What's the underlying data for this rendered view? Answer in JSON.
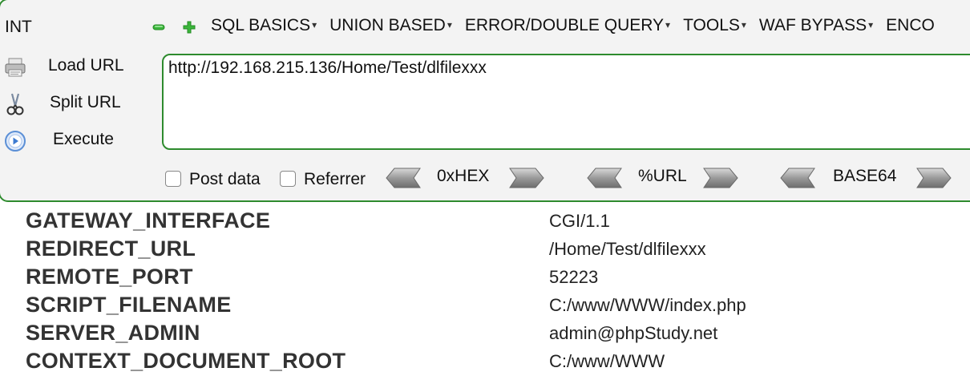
{
  "toolbar": {
    "name_fragment": "INT",
    "menu": [
      {
        "label": "SQL BASICS"
      },
      {
        "label": "UNION BASED"
      },
      {
        "label": "ERROR/DOUBLE QUERY"
      },
      {
        "label": "TOOLS"
      },
      {
        "label": "WAF BYPASS"
      },
      {
        "label": "ENCO"
      }
    ],
    "caret": "▾",
    "actions": {
      "load_url": "Load URL",
      "split_url": "Split URL",
      "execute": "Execute"
    },
    "url_value": "http://192.168.215.136/Home/Test/dlfilexxx",
    "post_data_label": "Post data",
    "referrer_label": "Referrer",
    "post_data_checked": false,
    "referrer_checked": false,
    "encoders": {
      "hex": "0xHEX",
      "url": "%URL",
      "base64": "BASE64"
    }
  },
  "env": [
    {
      "key": "GATEWAY_INTERFACE",
      "value": "CGI/1.1"
    },
    {
      "key": "REDIRECT_URL",
      "value": "/Home/Test/dlfilexxx"
    },
    {
      "key": "REMOTE_PORT",
      "value": "52223"
    },
    {
      "key": "SCRIPT_FILENAME",
      "value": "C:/www/WWW/index.php"
    },
    {
      "key": "SERVER_ADMIN",
      "value": "admin@phpStudy.net"
    },
    {
      "key": "CONTEXT_DOCUMENT_ROOT",
      "value": "C:/www/WWW"
    }
  ],
  "colors": {
    "panel_border": "#2e8b2e",
    "minus_icon": "#3bb53b",
    "plus_icon": "#3bb53b"
  },
  "icons": {
    "minus": "minus-icon",
    "plus": "plus-icon",
    "load_url": "printer-icon",
    "split_url": "scissors-icon",
    "execute": "play-circle-icon",
    "arrow_left": "arrow-left-icon",
    "arrow_right": "arrow-right-icon"
  }
}
